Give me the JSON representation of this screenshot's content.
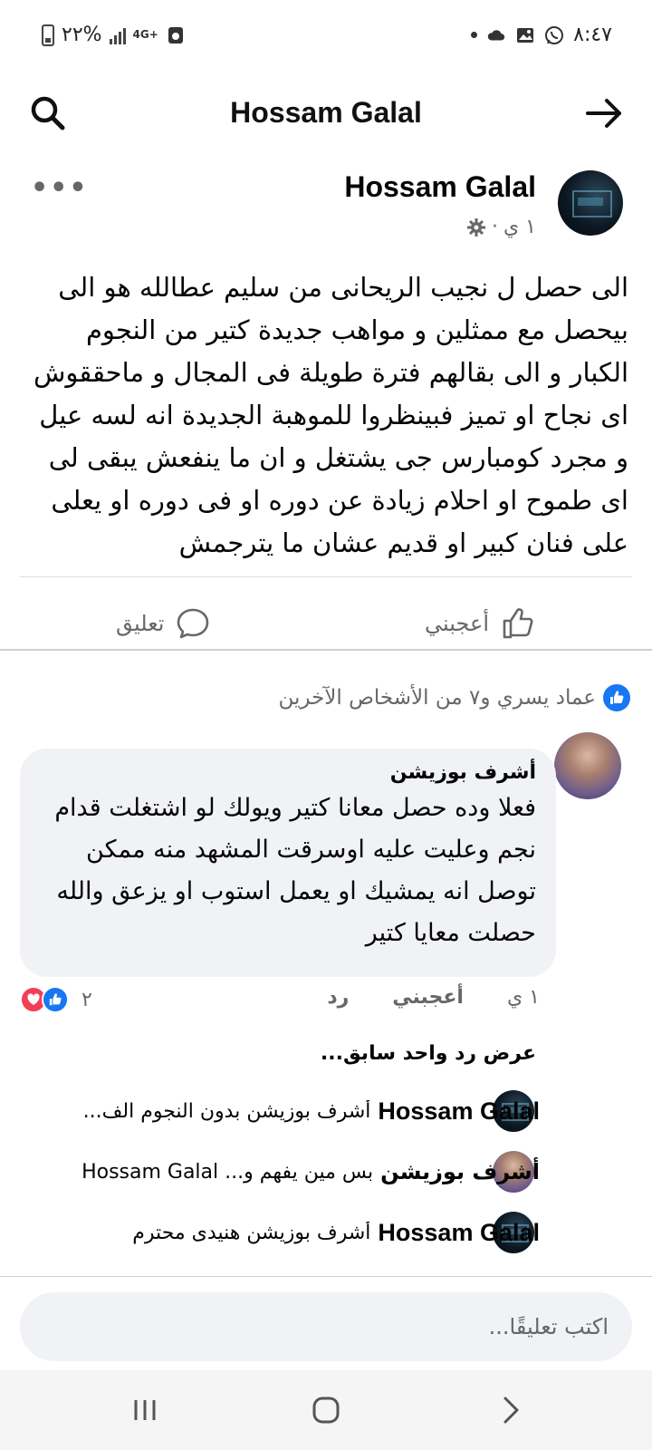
{
  "status_bar": {
    "time": "٨:٤٧",
    "battery": "٢٢%",
    "network": "4G+"
  },
  "header": {
    "title": "Hossam Galal",
    "icons": [
      "search-icon",
      "arrow-right-icon"
    ]
  },
  "post": {
    "author": "Hossam Galal",
    "timestamp": "١ ي",
    "dot": "·",
    "body": "الى حصل ل نجيب الريحانى من سليم عطالله هو الى بيحصل مع ممثلين و مواهب جديدة كتير من النجوم الكبار و الى بقالهم فترة طويلة فى المجال و ماحققوش اى نجاح او تميز فبينظروا للموهبة الجديدة انه لسه عيل و مجرد كومبارس جى يشتغل و ان ما ينفعش يبقى لى اى طموح او احلام زيادة عن دوره او فى دوره او يعلى على فنان كبير او قديم عشان ما يترجمش",
    "like_label": "أعجبني",
    "comment_label": "تعليق",
    "likers_text": "عماد يسري و٧ من الأشخاص الآخرين"
  },
  "comment": {
    "author": "أشرف بوزيشن",
    "text": "فعلا وده حصل معانا كتير ويولك لو اشتغلت قدام نجم وعليت عليه اوسرقت المشهد منه ممكن توصل انه يمشيك او يعمل استوب او يزعق والله حصلت معايا كتير",
    "time": "١ ي",
    "like_label": "أعجبني",
    "reply_label": "رد",
    "reaction_count": "٢",
    "view_previous": "عرض رد واحد سابق..."
  },
  "replies": [
    {
      "author": "Hossam Galal",
      "text": "أشرف بوزيشن  بدون النجوم الف..."
    },
    {
      "author": "أشرف بوزيشن",
      "text": "بس مين يفهم و... Hossam Galal"
    },
    {
      "author": "Hossam Galal",
      "text": "أشرف بوزيشن  هنيدى محترم"
    }
  ],
  "composer": {
    "placeholder": "اكتب تعليقًا..."
  },
  "colors": {
    "accent": "#1877f2",
    "secondary_text": "#65676b",
    "bubble": "#f0f2f5",
    "heart": "#f33e58"
  }
}
